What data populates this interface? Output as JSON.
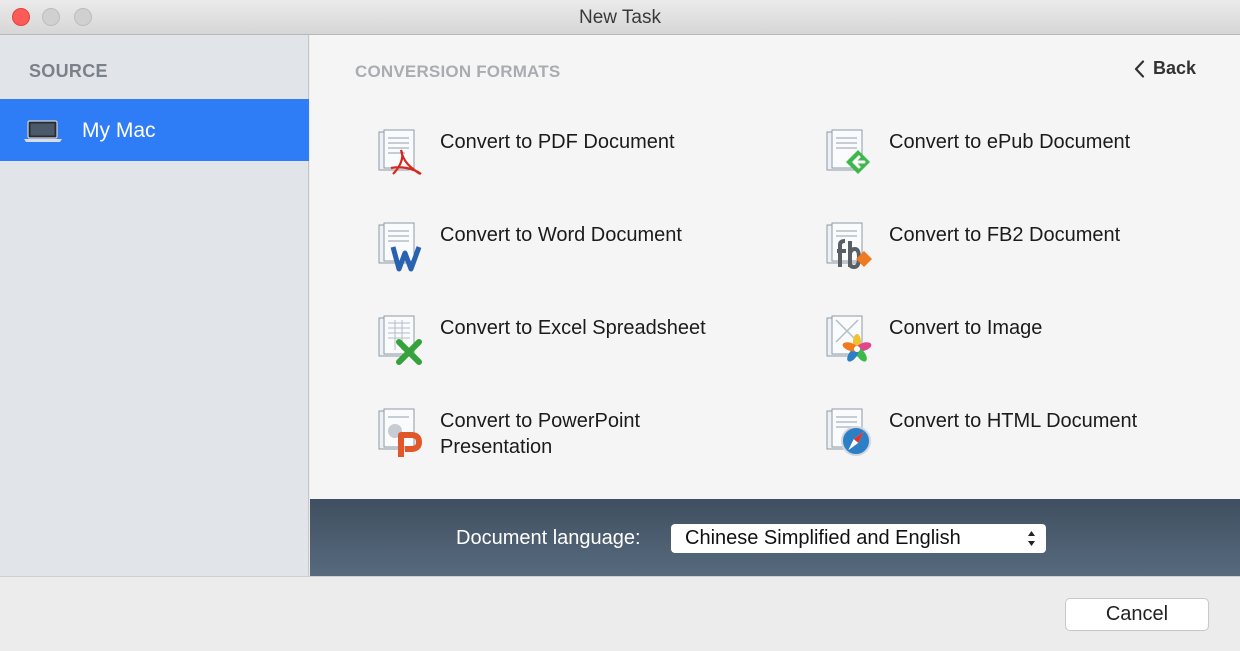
{
  "window": {
    "title": "New Task"
  },
  "sidebar": {
    "header": "SOURCE",
    "items": [
      {
        "label": "My Mac",
        "icon": "laptop-icon",
        "selected": true
      }
    ]
  },
  "main": {
    "section_title": "CONVERSION FORMATS",
    "back_label": "Back",
    "formats": [
      {
        "label": "Convert to PDF Document",
        "icon": "pdf-document-icon",
        "accent": "#d7261d"
      },
      {
        "label": "Convert to ePub Document",
        "icon": "epub-document-icon",
        "accent": "#3cb94a"
      },
      {
        "label": "Convert to Word Document",
        "icon": "word-document-icon",
        "accent": "#2a62b3"
      },
      {
        "label": "Convert to FB2 Document",
        "icon": "fb2-document-icon",
        "accent": "#f07a22"
      },
      {
        "label": "Convert to Excel Spreadsheet",
        "icon": "excel-spreadsheet-icon",
        "accent": "#35a23c"
      },
      {
        "label": "Convert to Image",
        "icon": "image-icon",
        "accent": "#e0468c"
      },
      {
        "label": "Convert to PowerPoint Presentation",
        "icon": "powerpoint-presentation-icon",
        "accent": "#e2572a"
      },
      {
        "label": "Convert to HTML Document",
        "icon": "html-document-icon",
        "accent": "#2c7fc5"
      }
    ]
  },
  "language": {
    "label": "Document language:",
    "selected": "Chinese Simplified and English"
  },
  "footer": {
    "cancel_label": "Cancel"
  },
  "colors": {
    "selection": "#2e7cf6",
    "bar_top": "#3f4f60",
    "bar_bottom": "#576a7d",
    "close": "#fc5b57"
  }
}
